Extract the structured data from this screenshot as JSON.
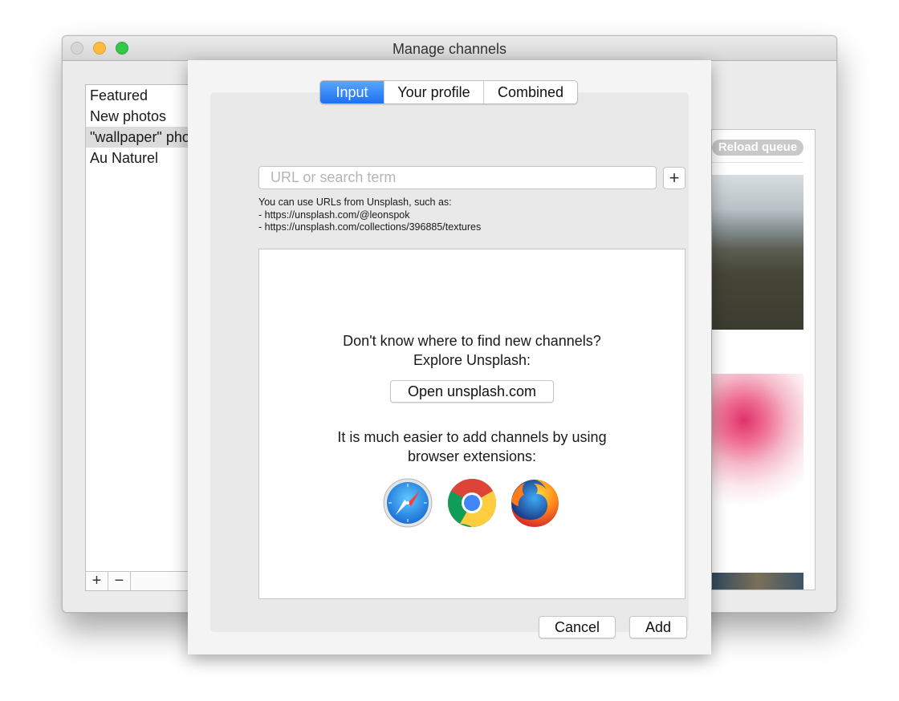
{
  "window": {
    "title": "Manage channels"
  },
  "channels": {
    "items": [
      {
        "label": "Featured",
        "selected": false
      },
      {
        "label": "New photos",
        "selected": false
      },
      {
        "label": "\"wallpaper\" photos",
        "selected": true
      },
      {
        "label": "Au Naturel",
        "selected": false
      }
    ],
    "add_label": "+",
    "remove_label": "−"
  },
  "queue": {
    "reload_label": "Reload queue"
  },
  "dialog": {
    "tabs": [
      {
        "label": "Input",
        "active": true
      },
      {
        "label": "Your profile",
        "active": false
      },
      {
        "label": "Combined",
        "active": false
      }
    ],
    "url_input": {
      "placeholder": "URL or search term",
      "value": ""
    },
    "add_url_label": "+",
    "hint_lines": [
      "You can use URLs from Unsplash, such as:",
      "- https://unsplash.com/@leonspok",
      "- https://unsplash.com/collections/396885/textures"
    ],
    "explore_text": [
      "Don't know where to find new channels?",
      "Explore Unsplash:"
    ],
    "open_button": "Open unsplash.com",
    "extensions_text": [
      "It is much easier to add channels by using",
      "browser extensions:"
    ],
    "browsers": [
      "safari-icon",
      "chrome-icon",
      "firefox-icon"
    ],
    "cancel_button": "Cancel",
    "add_button": "Add"
  },
  "colors": {
    "accent": "#1f6ff2",
    "traffic_close": "#d6d6d6",
    "traffic_minimize": "#fdbc40",
    "traffic_zoom": "#34c84a"
  }
}
